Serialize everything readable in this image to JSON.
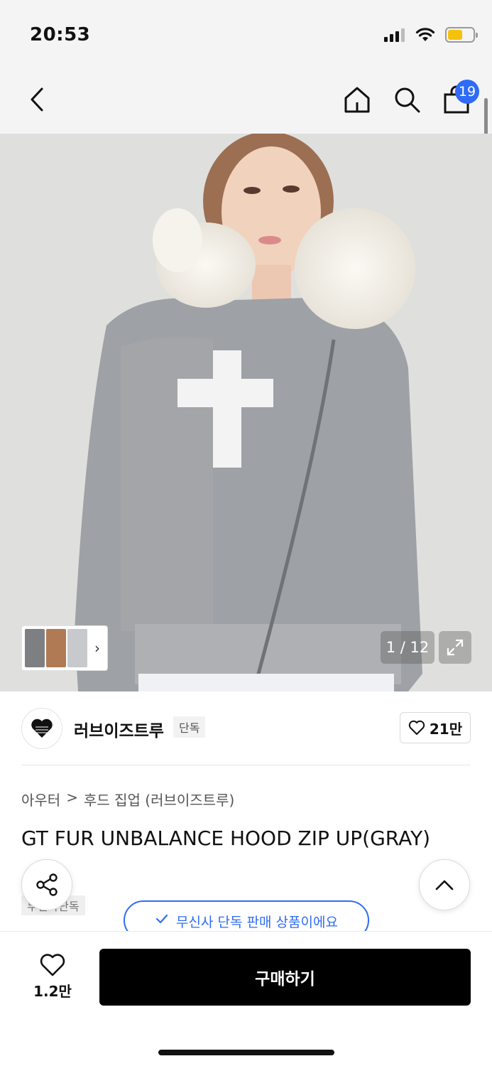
{
  "status_bar": {
    "time": "20:53",
    "battery_color": "#f4c20d"
  },
  "nav": {
    "cart_count": "19",
    "icons": [
      "back-chevron-icon",
      "home-icon",
      "search-icon",
      "cart-bag-icon"
    ]
  },
  "gallery": {
    "counter": "1 / 12",
    "thumb_count": 3
  },
  "brand": {
    "name": "러브이즈트루",
    "tag": "단독",
    "likes": "21만"
  },
  "breadcrumb": {
    "category": "아우터",
    "separator": ">",
    "subcategory": "후드 집업 (러브이즈트루)"
  },
  "product": {
    "title": "GT FUR UNBALANCE HOOD ZIP UP(GRAY)"
  },
  "badges": {
    "exclusive_tag": "무신사단독",
    "exclusive_banner": "무신사 단독 판매 상품이에요"
  },
  "bottom": {
    "wish_count": "1.2만",
    "buy_label": "구매하기"
  },
  "colors": {
    "accent": "#2f6bf6",
    "buy_button": "#000000"
  }
}
